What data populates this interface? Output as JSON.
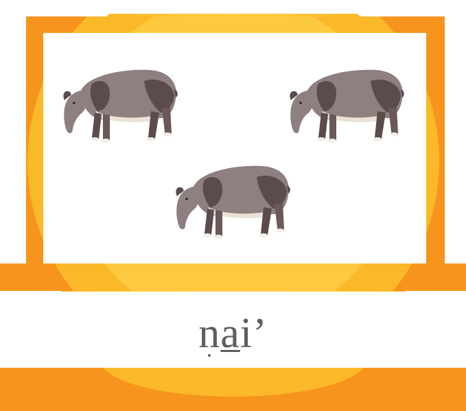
{
  "card": {
    "colors": {
      "frame_orange": "#F7941D",
      "glow_yellow": "#FFD54F",
      "glow_amber": "#FBB829",
      "panel_white": "#FFFFFF",
      "text_gray": "#5E5E5E"
    }
  },
  "picture": {
    "animal": "tapir",
    "count": 3
  },
  "word": {
    "part_n": "n",
    "part_a": "a",
    "part_rest": "i’"
  }
}
